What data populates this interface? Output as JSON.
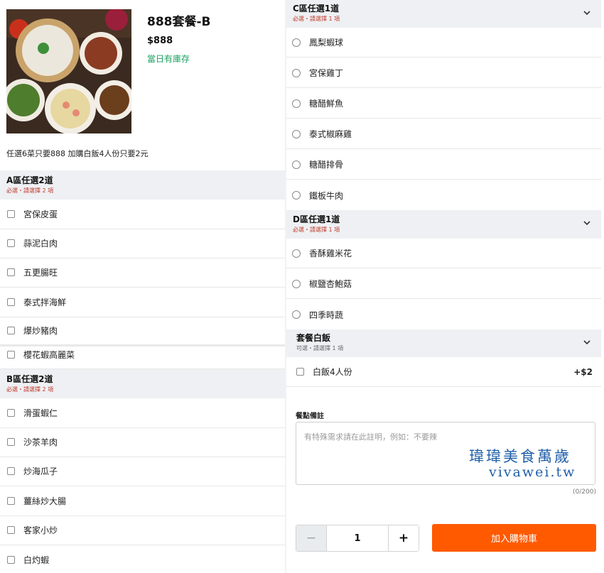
{
  "product": {
    "title": "888套餐-B",
    "price": "$888",
    "stock": "當日有庫存",
    "description": "任選6菜只要888 加購白飯4人份只要2元"
  },
  "section_a": {
    "title": "A區任選2道",
    "requirement": "必選・請選擇 2 項",
    "items": [
      "宮保皮蛋",
      "蒜泥白肉",
      "五更腸旺",
      "泰式拌海鮮",
      "爆炒豬肉",
      "櫻花蝦高麗菜"
    ]
  },
  "section_b": {
    "title": "B區任選2道",
    "requirement": "必選・請選擇 2 項",
    "items": [
      "滑蛋蝦仁",
      "沙茶羊肉",
      "炒海瓜子",
      "薑絲炒大腸",
      "客家小炒",
      "白灼蝦"
    ]
  },
  "section_c": {
    "title": "C區任選1道",
    "requirement": "必選・請選擇 1 項",
    "items": [
      "鳳梨蝦球",
      "宮保雞丁",
      "糖醋鮮魚",
      "泰式椒麻雞",
      "糖醋排骨",
      "鐵板牛肉"
    ]
  },
  "section_d": {
    "title": "D區任選1道",
    "requirement": "必選・請選擇 1 項",
    "items": [
      "香酥雞米花",
      "椒鹽杏鮑菇",
      "四季時蔬"
    ]
  },
  "section_rice": {
    "title": "套餐白飯",
    "requirement": "可選・請選擇 1 項",
    "item": "白飯4人份",
    "price": "+$2"
  },
  "notes": {
    "label": "餐點備註",
    "placeholder": "有特殊需求請在此註明，例如：不要辣",
    "counter": "(0/200)"
  },
  "watermark": {
    "line1": "瑋瑋美食萬歲",
    "line2": "vivawei.tw"
  },
  "quantity": {
    "minus": "−",
    "value": "1",
    "plus": "+"
  },
  "cart": {
    "add_label": "加入購物車"
  },
  "colors": {
    "accent": "#ff5a00",
    "stock": "#1aa260",
    "required": "#c0392b",
    "section_bg": "#eef0f3"
  }
}
